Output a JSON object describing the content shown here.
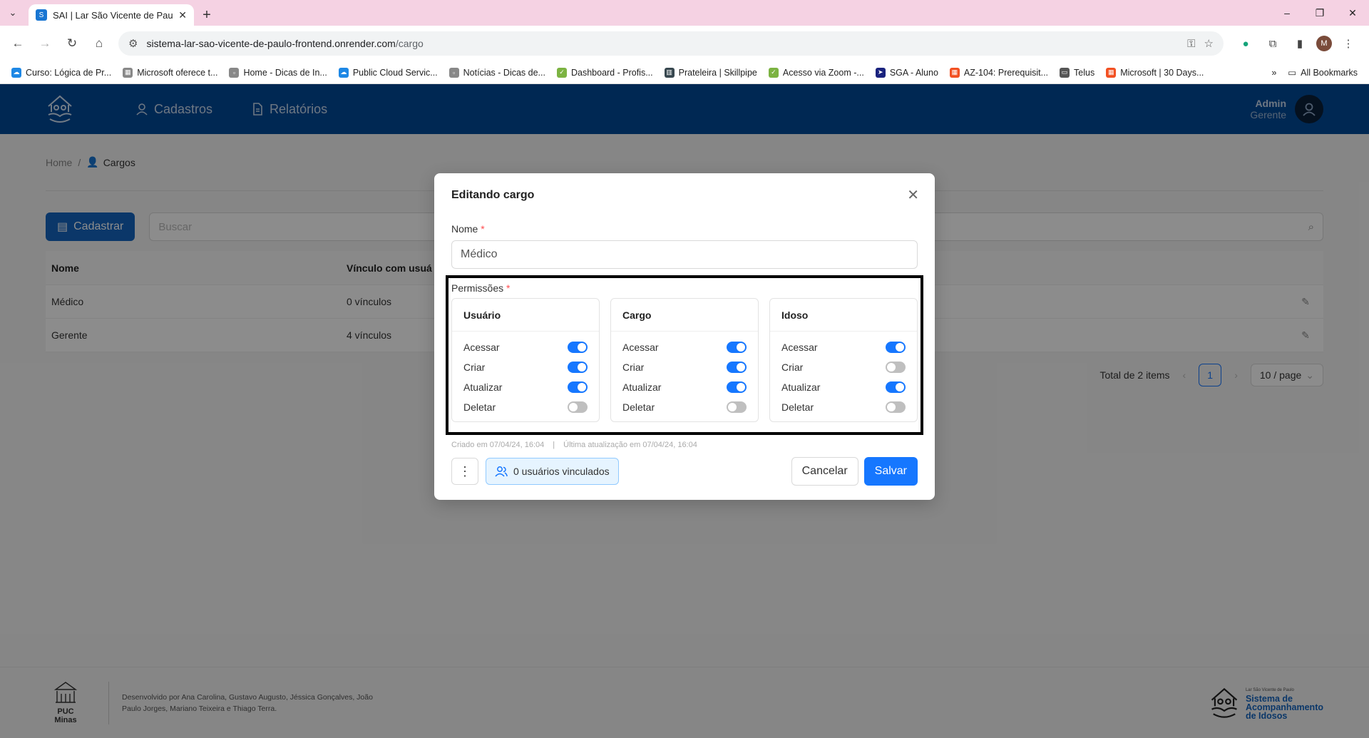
{
  "browser": {
    "tab_title": "SAI | Lar São Vicente de Paulo",
    "url_host": "sistema-lar-sao-vicente-de-paulo-frontend.onrender.com",
    "url_path": "/cargo",
    "profile_initial": "M",
    "bookmarks": [
      {
        "label": "Curso: Lógica de Pr...",
        "icon": "cloud-icon",
        "color": "#1e88e5"
      },
      {
        "label": "Microsoft oferece t...",
        "icon": "microsoft-icon",
        "color": "#888888"
      },
      {
        "label": "Home - Dicas de In...",
        "icon": "page-icon",
        "color": "#888888"
      },
      {
        "label": "Public Cloud Servic...",
        "icon": "cloud-icon",
        "color": "#1e88e5"
      },
      {
        "label": "Notícias - Dicas de...",
        "icon": "page-icon",
        "color": "#888888"
      },
      {
        "label": "Dashboard - Profis...",
        "icon": "check-icon",
        "color": "#7cb342"
      },
      {
        "label": "Prateleira | Skillpipe",
        "icon": "book-icon",
        "color": "#37474f"
      },
      {
        "label": "Acesso via Zoom -...",
        "icon": "check-icon",
        "color": "#7cb342"
      },
      {
        "label": "SGA - Aluno",
        "icon": "arrow-icon",
        "color": "#1a237e"
      },
      {
        "label": "AZ-104: Prerequisit...",
        "icon": "microsoft-icon",
        "color": "#f25022"
      },
      {
        "label": "Telus",
        "icon": "folder-icon",
        "color": "#555555"
      },
      {
        "label": "Microsoft | 30 Days...",
        "icon": "microsoft-icon",
        "color": "#f25022"
      }
    ],
    "all_bookmarks": "All Bookmarks"
  },
  "header": {
    "menu": [
      {
        "label": "Cadastros",
        "icon": "user-icon"
      },
      {
        "label": "Relatórios",
        "icon": "document-icon"
      }
    ],
    "user_name": "Admin",
    "user_role": "Gerente"
  },
  "breadcrumb": {
    "home": "Home",
    "separator": "/",
    "current": "Cargos"
  },
  "toolbar": {
    "create_label": "Cadastrar",
    "search_placeholder": "Buscar"
  },
  "table": {
    "columns": [
      "Nome",
      "Vínculo com usuá"
    ],
    "rows": [
      {
        "name": "Médico",
        "links": "0 vínculos"
      },
      {
        "name": "Gerente",
        "links": "4 vínculos"
      }
    ]
  },
  "pagination": {
    "total": "Total de 2 items",
    "current_page": "1",
    "page_size": "10 / page"
  },
  "footer": {
    "org": "PUC Minas",
    "credits": "Desenvolvido por Ana Carolina, Gustavo Augusto, Jéssica Gonçalves, João Paulo Jorges, Mariano Teixeira e Thiago Terra.",
    "brand_small": "Lar São Vicente de Paulo",
    "brand_line1": "Sistema de",
    "brand_line2": "Acompanhamento",
    "brand_line3": "de Idosos"
  },
  "modal": {
    "title": "Editando cargo",
    "name_label": "Nome",
    "name_value": "Médico",
    "permissions_label": "Permissões",
    "required_mark": "*",
    "cards": [
      {
        "title": "Usuário",
        "perms": [
          {
            "label": "Acessar",
            "on": true
          },
          {
            "label": "Criar",
            "on": true
          },
          {
            "label": "Atualizar",
            "on": true
          },
          {
            "label": "Deletar",
            "on": false
          }
        ]
      },
      {
        "title": "Cargo",
        "perms": [
          {
            "label": "Acessar",
            "on": true
          },
          {
            "label": "Criar",
            "on": true
          },
          {
            "label": "Atualizar",
            "on": true
          },
          {
            "label": "Deletar",
            "on": false
          }
        ]
      },
      {
        "title": "Idoso",
        "perms": [
          {
            "label": "Acessar",
            "on": true
          },
          {
            "label": "Criar",
            "on": false
          },
          {
            "label": "Atualizar",
            "on": true
          },
          {
            "label": "Deletar",
            "on": false
          }
        ]
      }
    ],
    "created": "Criado em 07/04/24, 16:04",
    "meta_sep": "|",
    "updated": "Última atualização em 07/04/24, 16:04",
    "linked_users": "0 usuários vinculados",
    "cancel": "Cancelar",
    "save": "Salvar"
  },
  "colors": {
    "header_bg": "#004a97",
    "primary": "#1677ff",
    "tab_strip": "#f5d2e3"
  }
}
